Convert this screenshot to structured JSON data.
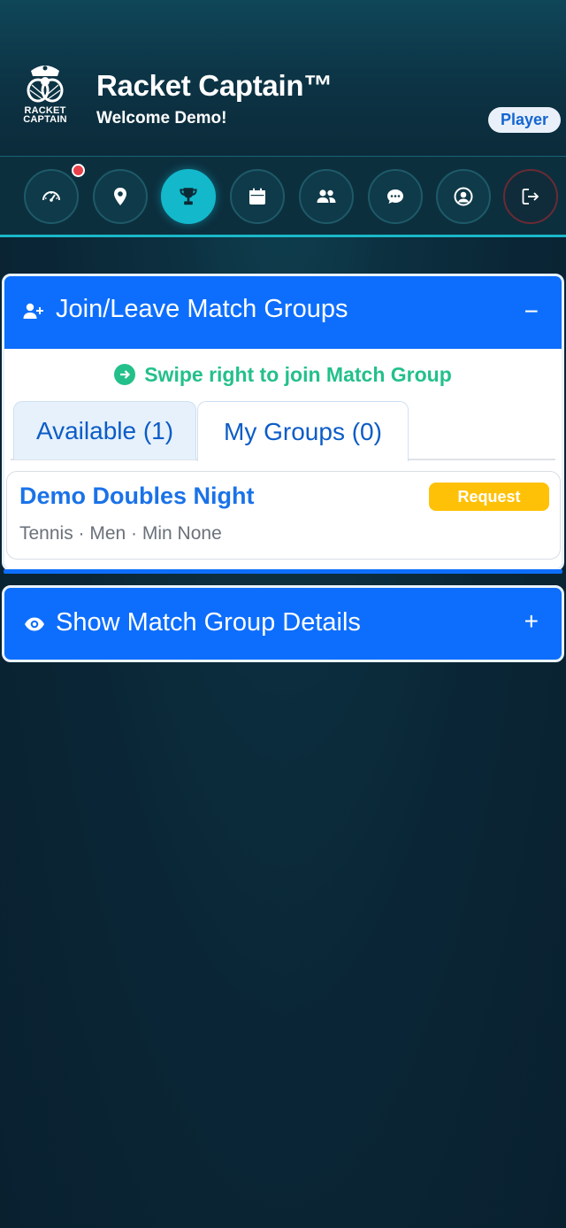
{
  "header": {
    "logo_text": "RACKET CAPTAIN",
    "app_title": "Racket Captain™",
    "welcome": "Welcome Demo!",
    "role_badge": "Player"
  },
  "nav": {
    "items": [
      {
        "name": "dashboard",
        "icon": "speedometer-icon",
        "active": false,
        "has_notification": true
      },
      {
        "name": "locations",
        "icon": "map-pin-icon",
        "active": false
      },
      {
        "name": "match-groups",
        "icon": "trophy-icon",
        "active": true
      },
      {
        "name": "calendar",
        "icon": "calendar-icon",
        "active": false
      },
      {
        "name": "players",
        "icon": "users-icon",
        "active": false
      },
      {
        "name": "messages",
        "icon": "chat-icon",
        "active": false
      },
      {
        "name": "profile",
        "icon": "user-circle-icon",
        "active": false
      },
      {
        "name": "logout",
        "icon": "logout-icon",
        "active": false
      }
    ]
  },
  "join_panel": {
    "title": "Join/Leave Match Groups",
    "toggle": "−",
    "swipe_hint": "Swipe right to join Match Group",
    "tabs": [
      {
        "label": "Available (1)",
        "active": true
      },
      {
        "label": "My Groups (0)",
        "active": false
      }
    ],
    "groups": [
      {
        "name": "Demo Doubles Night",
        "meta": "Tennis · Men · Min None",
        "action": "Request"
      }
    ]
  },
  "details_panel": {
    "title": "Show Match Group Details",
    "toggle": "+"
  },
  "colors": {
    "primary": "#0d6efd",
    "accent_teal": "#13b8cb",
    "success": "#23c08a",
    "warning": "#ffc107",
    "notification": "#e8404a"
  }
}
